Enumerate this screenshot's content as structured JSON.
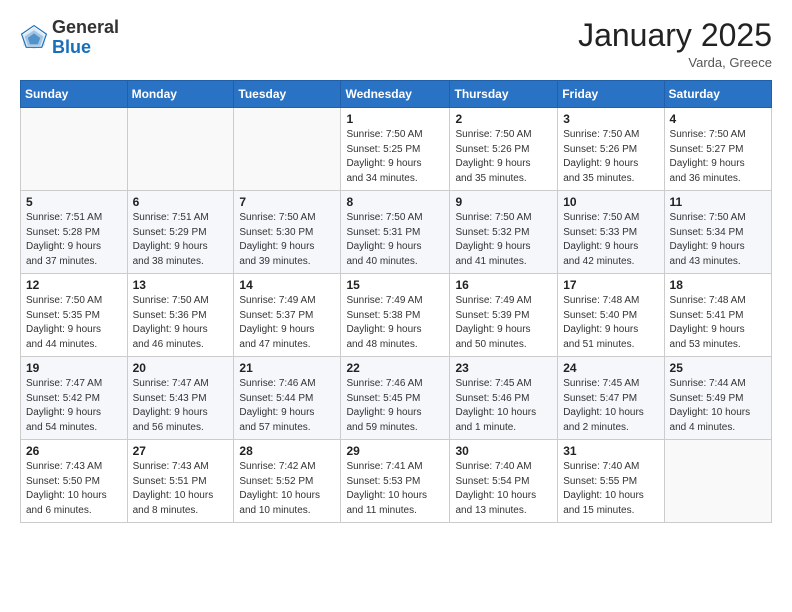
{
  "header": {
    "logo_general": "General",
    "logo_blue": "Blue",
    "title": "January 2025",
    "subtitle": "Varda, Greece"
  },
  "weekdays": [
    "Sunday",
    "Monday",
    "Tuesday",
    "Wednesday",
    "Thursday",
    "Friday",
    "Saturday"
  ],
  "weeks": [
    [
      {
        "day": "",
        "info": ""
      },
      {
        "day": "",
        "info": ""
      },
      {
        "day": "",
        "info": ""
      },
      {
        "day": "1",
        "info": "Sunrise: 7:50 AM\nSunset: 5:25 PM\nDaylight: 9 hours\nand 34 minutes."
      },
      {
        "day": "2",
        "info": "Sunrise: 7:50 AM\nSunset: 5:26 PM\nDaylight: 9 hours\nand 35 minutes."
      },
      {
        "day": "3",
        "info": "Sunrise: 7:50 AM\nSunset: 5:26 PM\nDaylight: 9 hours\nand 35 minutes."
      },
      {
        "day": "4",
        "info": "Sunrise: 7:50 AM\nSunset: 5:27 PM\nDaylight: 9 hours\nand 36 minutes."
      }
    ],
    [
      {
        "day": "5",
        "info": "Sunrise: 7:51 AM\nSunset: 5:28 PM\nDaylight: 9 hours\nand 37 minutes."
      },
      {
        "day": "6",
        "info": "Sunrise: 7:51 AM\nSunset: 5:29 PM\nDaylight: 9 hours\nand 38 minutes."
      },
      {
        "day": "7",
        "info": "Sunrise: 7:50 AM\nSunset: 5:30 PM\nDaylight: 9 hours\nand 39 minutes."
      },
      {
        "day": "8",
        "info": "Sunrise: 7:50 AM\nSunset: 5:31 PM\nDaylight: 9 hours\nand 40 minutes."
      },
      {
        "day": "9",
        "info": "Sunrise: 7:50 AM\nSunset: 5:32 PM\nDaylight: 9 hours\nand 41 minutes."
      },
      {
        "day": "10",
        "info": "Sunrise: 7:50 AM\nSunset: 5:33 PM\nDaylight: 9 hours\nand 42 minutes."
      },
      {
        "day": "11",
        "info": "Sunrise: 7:50 AM\nSunset: 5:34 PM\nDaylight: 9 hours\nand 43 minutes."
      }
    ],
    [
      {
        "day": "12",
        "info": "Sunrise: 7:50 AM\nSunset: 5:35 PM\nDaylight: 9 hours\nand 44 minutes."
      },
      {
        "day": "13",
        "info": "Sunrise: 7:50 AM\nSunset: 5:36 PM\nDaylight: 9 hours\nand 46 minutes."
      },
      {
        "day": "14",
        "info": "Sunrise: 7:49 AM\nSunset: 5:37 PM\nDaylight: 9 hours\nand 47 minutes."
      },
      {
        "day": "15",
        "info": "Sunrise: 7:49 AM\nSunset: 5:38 PM\nDaylight: 9 hours\nand 48 minutes."
      },
      {
        "day": "16",
        "info": "Sunrise: 7:49 AM\nSunset: 5:39 PM\nDaylight: 9 hours\nand 50 minutes."
      },
      {
        "day": "17",
        "info": "Sunrise: 7:48 AM\nSunset: 5:40 PM\nDaylight: 9 hours\nand 51 minutes."
      },
      {
        "day": "18",
        "info": "Sunrise: 7:48 AM\nSunset: 5:41 PM\nDaylight: 9 hours\nand 53 minutes."
      }
    ],
    [
      {
        "day": "19",
        "info": "Sunrise: 7:47 AM\nSunset: 5:42 PM\nDaylight: 9 hours\nand 54 minutes."
      },
      {
        "day": "20",
        "info": "Sunrise: 7:47 AM\nSunset: 5:43 PM\nDaylight: 9 hours\nand 56 minutes."
      },
      {
        "day": "21",
        "info": "Sunrise: 7:46 AM\nSunset: 5:44 PM\nDaylight: 9 hours\nand 57 minutes."
      },
      {
        "day": "22",
        "info": "Sunrise: 7:46 AM\nSunset: 5:45 PM\nDaylight: 9 hours\nand 59 minutes."
      },
      {
        "day": "23",
        "info": "Sunrise: 7:45 AM\nSunset: 5:46 PM\nDaylight: 10 hours\nand 1 minute."
      },
      {
        "day": "24",
        "info": "Sunrise: 7:45 AM\nSunset: 5:47 PM\nDaylight: 10 hours\nand 2 minutes."
      },
      {
        "day": "25",
        "info": "Sunrise: 7:44 AM\nSunset: 5:49 PM\nDaylight: 10 hours\nand 4 minutes."
      }
    ],
    [
      {
        "day": "26",
        "info": "Sunrise: 7:43 AM\nSunset: 5:50 PM\nDaylight: 10 hours\nand 6 minutes."
      },
      {
        "day": "27",
        "info": "Sunrise: 7:43 AM\nSunset: 5:51 PM\nDaylight: 10 hours\nand 8 minutes."
      },
      {
        "day": "28",
        "info": "Sunrise: 7:42 AM\nSunset: 5:52 PM\nDaylight: 10 hours\nand 10 minutes."
      },
      {
        "day": "29",
        "info": "Sunrise: 7:41 AM\nSunset: 5:53 PM\nDaylight: 10 hours\nand 11 minutes."
      },
      {
        "day": "30",
        "info": "Sunrise: 7:40 AM\nSunset: 5:54 PM\nDaylight: 10 hours\nand 13 minutes."
      },
      {
        "day": "31",
        "info": "Sunrise: 7:40 AM\nSunset: 5:55 PM\nDaylight: 10 hours\nand 15 minutes."
      },
      {
        "day": "",
        "info": ""
      }
    ]
  ]
}
